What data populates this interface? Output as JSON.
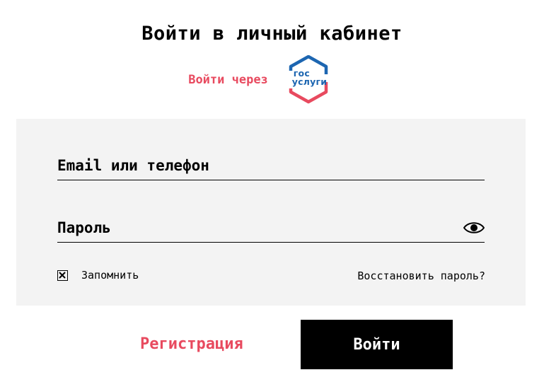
{
  "title": "Войти в личный кабинет",
  "gosuslugi": {
    "label": "Войти через",
    "logo_line1": "гос",
    "logo_line2": "услуги",
    "logo_colors": {
      "blue": "#1d66b1",
      "red": "#e84a5f"
    }
  },
  "form": {
    "email_placeholder": "Email или телефон",
    "password_placeholder": "Пароль",
    "show_password_icon": "eye-icon",
    "remember_label": "Запомнить",
    "remember_checked": true,
    "restore_link": "Восстановить пароль?"
  },
  "actions": {
    "register_label": "Регистрация",
    "login_label": "Войти"
  },
  "colors": {
    "accent": "#e84a5f",
    "panel_bg": "#f3f3f3",
    "button_bg": "#000000"
  }
}
